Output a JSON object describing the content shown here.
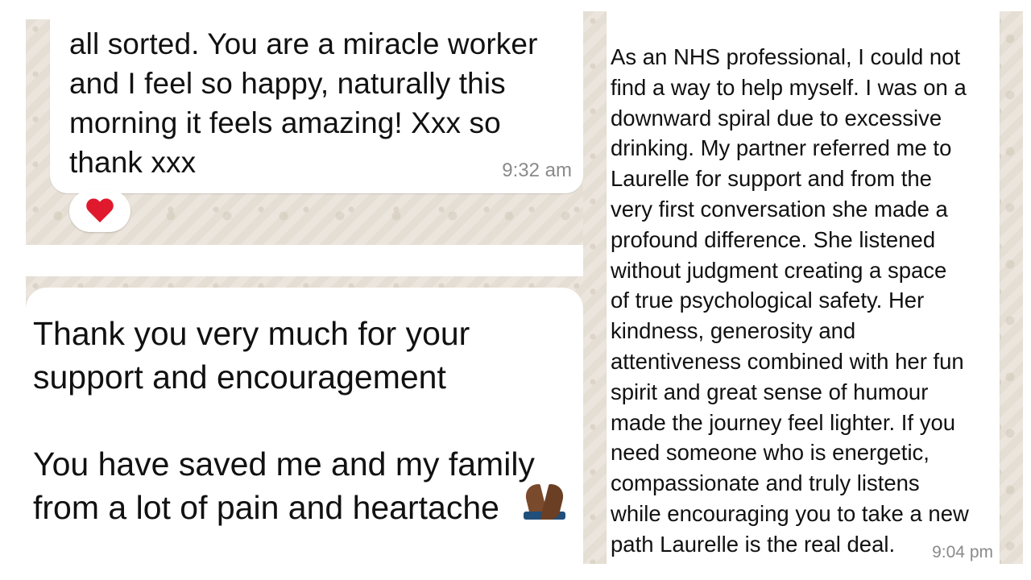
{
  "screenshots": [
    {
      "message": "all sorted. You are a miracle worker\nand I feel so happy, naturally this\nmorning it feels amazing! Xxx so\nthank xxx",
      "time": "9:32 am",
      "reaction": "heart-emoji"
    },
    {
      "message": "Thank you very much for your\nsupport and encouragement\n\nYou have saved me and my family\nfrom a lot of pain and heartache",
      "emoji": "folded-hands-emoji"
    },
    {
      "message": "As an NHS professional, I could not\nfind a way to help myself. I was on a\ndownward spiral due to excessive\ndrinking. My partner referred me to\nLaurelle for support and from the\nvery first conversation she made a\nprofound difference. She listened\nwithout judgment creating a space\nof true psychological safety. Her\nkindness, generosity and\nattentiveness combined with her fun\nspirit and great sense of humour\nmade the journey feel lighter. If you\nneed someone who is energetic,\ncompassionate and truly listens\nwhile encouraging you to take a new\npath Laurelle is the real deal.",
      "time": "9:04 pm"
    }
  ],
  "colors": {
    "chat_background": "#ece5dd",
    "bubble": "#ffffff",
    "time_text": "#8a8a8a",
    "heart": "#e0192d"
  }
}
